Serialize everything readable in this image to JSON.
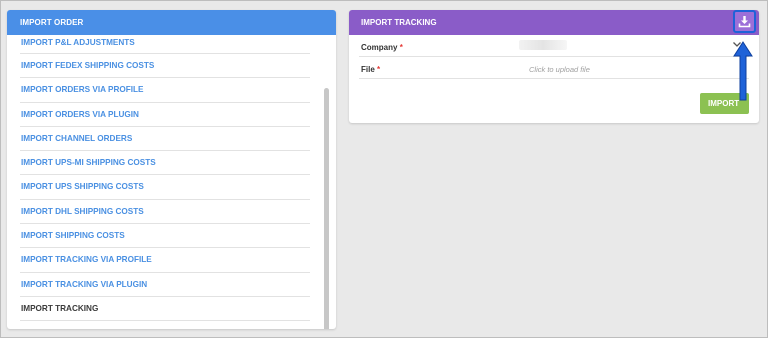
{
  "left_panel": {
    "title": "IMPORT ORDER",
    "items": [
      {
        "label": "IMPORT P&L ADJUSTMENTS"
      },
      {
        "label": "IMPORT FEDEX SHIPPING COSTS"
      },
      {
        "label": "IMPORT ORDERS VIA PROFILE"
      },
      {
        "label": "IMPORT ORDERS VIA PLUGIN"
      },
      {
        "label": "IMPORT CHANNEL ORDERS"
      },
      {
        "label": "IMPORT UPS-MI SHIPPING COSTS"
      },
      {
        "label": "IMPORT UPS SHIPPING COSTS"
      },
      {
        "label": "IMPORT DHL SHIPPING COSTS"
      },
      {
        "label": "IMPORT SHIPPING COSTS"
      },
      {
        "label": "IMPORT TRACKING VIA PROFILE"
      },
      {
        "label": "IMPORT TRACKING VIA PLUGIN"
      },
      {
        "label": "IMPORT TRACKING",
        "active": true
      }
    ]
  },
  "right_panel": {
    "title": "IMPORT TRACKING",
    "download_icon": "download-icon",
    "company": {
      "label": "Company",
      "required": "*",
      "icon": "chevron-down-icon"
    },
    "file": {
      "label": "File",
      "required": "*",
      "placeholder": "Click to upload file"
    },
    "import_button": "IMPORT"
  },
  "colors": {
    "left_header": "#4a8fe7",
    "right_header": "#8a5cc8",
    "link": "#4a90e2",
    "import_button": "#8cc152",
    "highlight": "#1e62d8"
  }
}
